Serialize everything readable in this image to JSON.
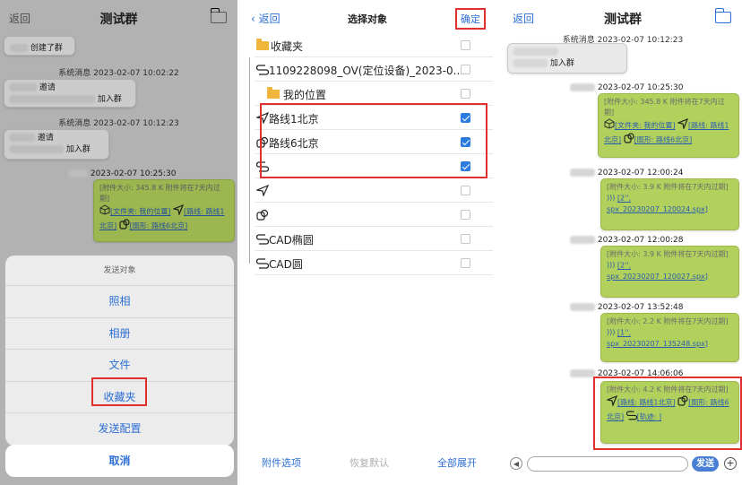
{
  "p1": {
    "back": "返回",
    "title": "测试群",
    "msg_top": "创建了群",
    "sys_time1": "系统消息 2023-02-07 10:02:22",
    "invite1_a": "邀请",
    "invite1_b": "加入群",
    "sys_time2": "系统消息 2023-02-07 10:12:23",
    "invite2_a": "邀请",
    "invite2_b": "加入群",
    "sender_time": "2023-02-07 10:25:30",
    "att_size": "[附件大小: 345.8 K 附件将在7天内过期]",
    "att_folder": "[文件夹: 我的位置]",
    "att_route": "[路线: 路线1北京]",
    "att_shape": "[图形: 路线6北京]",
    "sheet_title": "发送对象",
    "sheet_items": [
      "照相",
      "相册",
      "文件",
      "收藏夹",
      "发送配置"
    ],
    "cancel": "取消"
  },
  "p2": {
    "back": "返回",
    "title": "选择对象",
    "confirm": "确定",
    "rows": [
      {
        "label": "收藏夹",
        "checked": false
      },
      {
        "label": "1109228098_OV(定位设备)_2023-0...",
        "checked": false
      },
      {
        "label": "我的位置",
        "checked": false
      },
      {
        "label": "路线1北京",
        "checked": true
      },
      {
        "label": "路线6北京",
        "checked": true
      },
      {
        "label": "",
        "checked": true
      },
      {
        "label": "",
        "checked": false
      },
      {
        "label": "",
        "checked": false
      },
      {
        "label": "CAD椭圆",
        "checked": false
      },
      {
        "label": "CAD圆",
        "checked": false
      }
    ],
    "bottom_left": "附件选项",
    "bottom_mid": "恢复默认",
    "bottom_right": "全部展开"
  },
  "p3": {
    "back": "返回",
    "title": "测试群",
    "sys_time": "系统消息 2023-02-07 10:12:23",
    "invite_b": "加入群",
    "messages": [
      {
        "time": "2023-02-07 10:25:30",
        "size": "[附件大小: 345.8 K 附件将在7天内过期]",
        "folder": "[文件夹: 我的位置]",
        "route": "[路线: 路线1北京]",
        "shape": "[图形: 路线6北京]"
      },
      {
        "time": "2023-02-07 12:00:24",
        "size": "[附件大小: 3.9 K 附件将在7天内过期]",
        "file": "[2'', spx_20230207_120024.spx]"
      },
      {
        "time": "2023-02-07 12:00:28",
        "size": "[附件大小: 3.9 K 附件将在7天内过期]",
        "file": "[2'', spx_20230207_120027.spx]"
      },
      {
        "time": "2023-02-07 13:52:48",
        "size": "[附件大小: 2.2 K 附件将在7天内过期]",
        "file": "[1'', spx_20230207_135248.spx]"
      },
      {
        "time": "2023-02-07 14:06:06",
        "size": "[附件大小: 4.2 K 附件将在7天内过期]",
        "route": "[路线: 路线1北京]",
        "shape": "[图形: 路线6北京]",
        "track": "[轨迹: ]"
      }
    ],
    "send": "发送"
  }
}
